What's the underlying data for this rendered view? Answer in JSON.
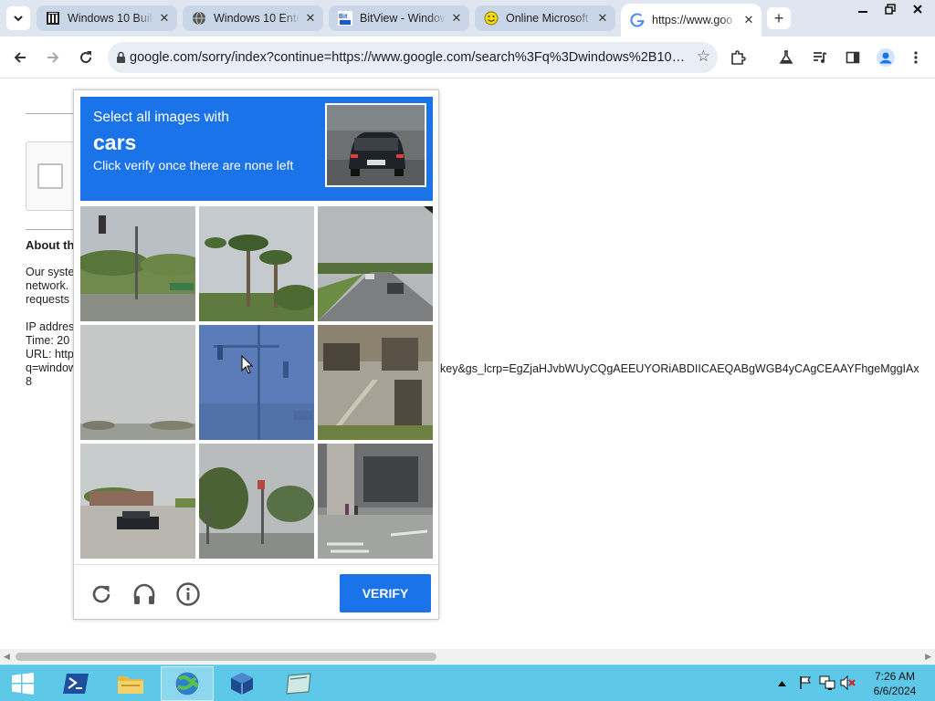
{
  "browser": {
    "tabs": [
      {
        "title": "Windows 10 Build",
        "favicon": "archive-icon",
        "active": false
      },
      {
        "title": "Windows 10 Ente",
        "favicon": "globe-icon",
        "active": false
      },
      {
        "title": "BitView - Window",
        "favicon": "bitview-icon",
        "active": false
      },
      {
        "title": "Online Microsoft",
        "favicon": "smiley-icon",
        "active": false
      },
      {
        "title": "https://www.goo",
        "favicon": "google-g-icon",
        "active": true
      }
    ],
    "new_tab": "+",
    "close_glyph": "✕",
    "url": "google.com/sorry/index?continue=https://www.google.com/search%3Fq%3Dwindows%2B10%2B...",
    "accent": "#1a73e8"
  },
  "page": {
    "about_heading": "About th",
    "para_lines": [
      "Our syste",
      "network.",
      "requests"
    ],
    "ip_label": "IP addres",
    "time_label": "Time: 20",
    "url_label": "URL: http",
    "url_cont": "q=window",
    "url_end": "8",
    "url_tail": "key&gs_lcrp=EgZjaHJvbWUyCQgAEEUYORiABDIICAEQABgWGB4yCAgCEAAYFhgeMggIAx"
  },
  "captcha": {
    "instruction_line1": "Select all images with",
    "target": "cars",
    "instruction_line3": "Click verify once there are none left",
    "verify_label": "VERIFY",
    "tiles": [
      {
        "name": "tile-traffic-light-trees",
        "selected": false
      },
      {
        "name": "tile-palm-trees",
        "selected": false
      },
      {
        "name": "tile-highway-cars",
        "selected": false
      },
      {
        "name": "tile-faded-street",
        "selected": false
      },
      {
        "name": "tile-traffic-signal",
        "selected": true
      },
      {
        "name": "tile-building-stairs",
        "selected": false
      },
      {
        "name": "tile-parking-car",
        "selected": false
      },
      {
        "name": "tile-intersection",
        "selected": false
      },
      {
        "name": "tile-crosswalk-building",
        "selected": false
      }
    ]
  },
  "taskbar": {
    "clock_time": "7:26 AM",
    "clock_date": "6/6/2024"
  }
}
